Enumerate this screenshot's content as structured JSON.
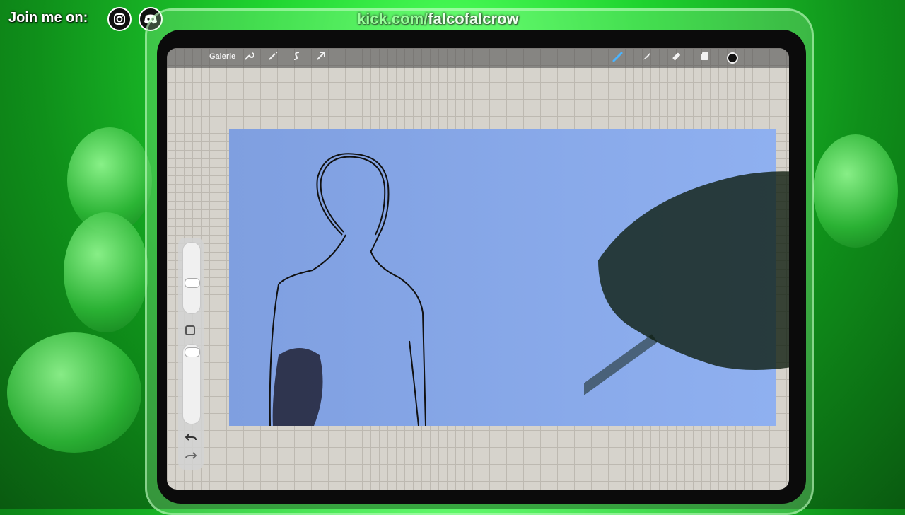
{
  "overlay": {
    "join_label": "Join me on:",
    "social_icons": [
      "instagram-icon",
      "discord-icon"
    ],
    "kick_domain": "kick.com/",
    "kick_channel": "falcofalcrow"
  },
  "app": {
    "gallery_label": "Galerie",
    "left_tools": [
      "wrench-icon",
      "magic-wand-icon",
      "selection-icon",
      "transform-arrow-icon"
    ],
    "right_tools": [
      "brush-icon",
      "smudge-icon",
      "eraser-icon",
      "layers-icon"
    ],
    "selected_tool": "brush-icon",
    "current_color": "#111111"
  },
  "colors": {
    "background_green": "#1fd42f",
    "canvas_blue": "#8aaaf0",
    "paper_grid": "#d6d3cc"
  }
}
